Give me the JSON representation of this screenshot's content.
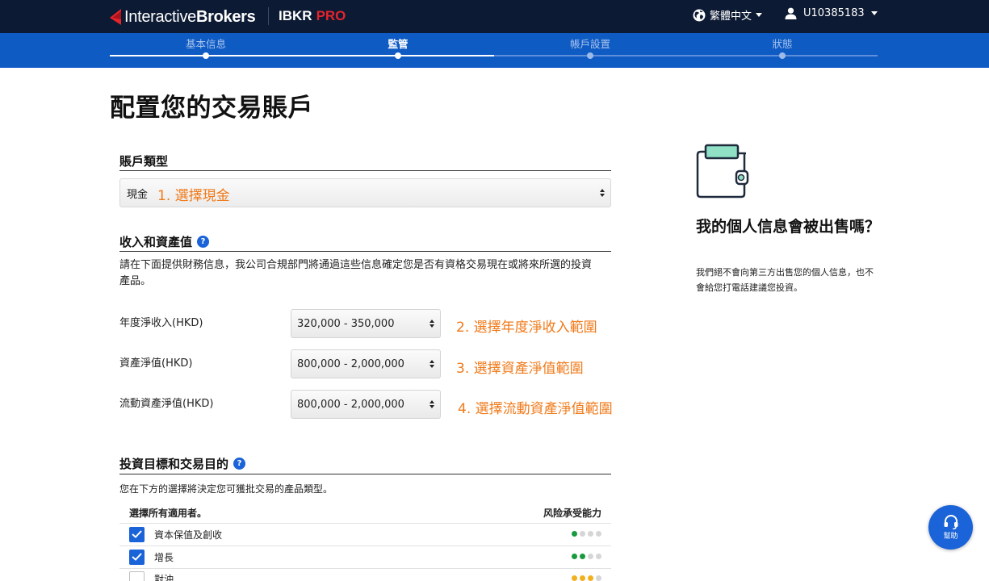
{
  "header": {
    "logo_text_regular": "Interactive",
    "logo_text_bold": "Brokers",
    "product_prefix": "IBKR",
    "product_suffix": "PRO",
    "language": "繁體中文",
    "user_id": "U10385183"
  },
  "stepper": {
    "steps": [
      {
        "label": "基本信息",
        "state": "done"
      },
      {
        "label": "監管",
        "state": "active"
      },
      {
        "label": "帳戶設置",
        "state": "todo"
      },
      {
        "label": "狀態",
        "state": "todo"
      }
    ]
  },
  "page": {
    "title": "配置您的交易賬戶"
  },
  "account_type": {
    "section_title": "賬戶類型",
    "selected_value": "現金",
    "annotation": "1. 選擇現金"
  },
  "income_assets": {
    "section_title": "收入和資產值",
    "help_glyph": "?",
    "description_line1": "請在下面提供財務信息，我公司合規部門將通過這些信息確定您是否有資格交易現在或將來所選的投資",
    "description_line2": "產品。",
    "rows": [
      {
        "label": "年度淨收入(HKD)",
        "value": "320,000 - 350,000",
        "annotation": "2. 選擇年度淨收入範圍"
      },
      {
        "label": "資產淨值(HKD)",
        "value": "800,000 - 2,000,000",
        "annotation": "3. 選擇資產淨值範圍"
      },
      {
        "label": "流動資產淨值(HKD)",
        "value": "800,000 - 2,000,000",
        "annotation": "4. 選擇流動資產淨值範圍"
      }
    ]
  },
  "objectives": {
    "section_title": "投資目標和交易目的",
    "help_glyph": "?",
    "description": "您在下方的選擇將決定您可獲批交易的產品類型。",
    "select_all_header": "選擇所有適用者。",
    "risk_header": "风险承受能力",
    "items": [
      {
        "label": "資本保值及創收",
        "checked": true,
        "risk_level": 1,
        "risk_color": "#1a9a3c"
      },
      {
        "label": "增長",
        "checked": true,
        "risk_level": 2,
        "risk_color": "#1a9a3c"
      },
      {
        "label": "對沖",
        "checked": false,
        "risk_level": 3,
        "risk_color": "#f2b01e"
      }
    ]
  },
  "side_panel": {
    "title": "我的個人信息會被出售嗎？",
    "text": "我們絕不會向第三方出售您的個人信息，也不會給您打電話建議您投資。"
  },
  "help_button": {
    "label": "幫助"
  },
  "colors": {
    "topbar": "#0c1a33",
    "stepbar": "#0f5bc4",
    "accent": "#1a63d8",
    "annotation": "#f07a1a",
    "brand_red": "#e3242b",
    "risk_empty": "#d6d6d6"
  }
}
